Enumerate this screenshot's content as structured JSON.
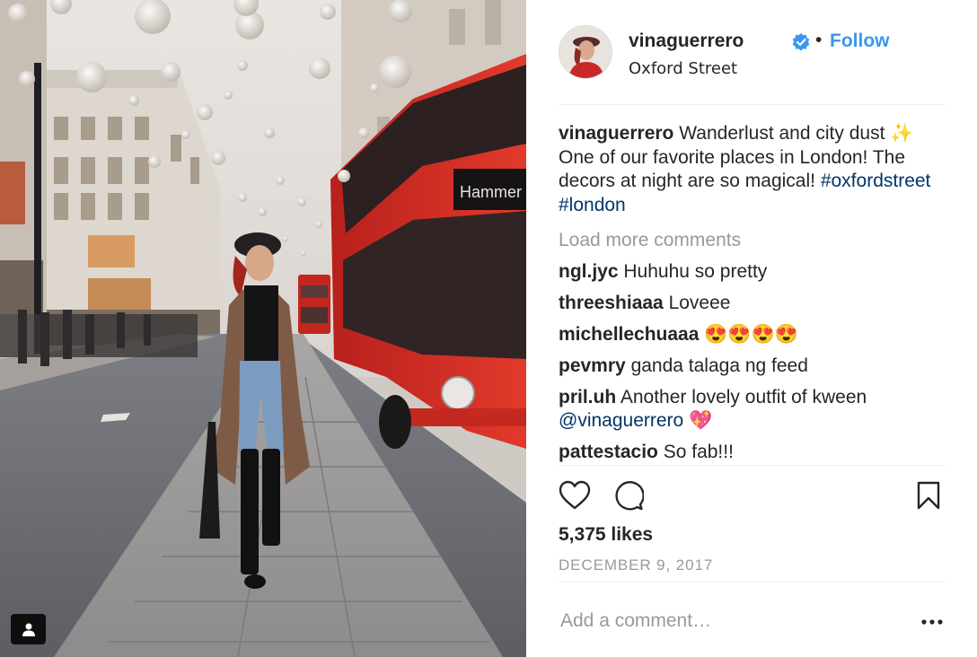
{
  "post": {
    "username": "vinaguerrero",
    "separator": "•",
    "follow_label": "Follow",
    "location": "Oxford Street",
    "verified_icon": "verified-badge-icon",
    "accent_color": "#3897f0",
    "link_color": "#003569"
  },
  "caption": {
    "username": "vinaguerrero",
    "text": "Wanderlust and city dust ✨ One of our favorite places in London! The decors at night are so magical!",
    "hashtags": [
      "#oxfordstreet",
      "#london"
    ]
  },
  "load_more_label": "Load more comments",
  "comments": [
    {
      "user": "ngl.jyc",
      "text": "Huhuhu so pretty"
    },
    {
      "user": "threeshiaaa",
      "text": "Loveee"
    },
    {
      "user": "michellechuaaa",
      "text": "😍😍😍😍"
    },
    {
      "user": "pevmry",
      "text": "ganda talaga ng feed"
    },
    {
      "user": "pril.uh",
      "text": "Another lovely outfit of kween",
      "mention": "@vinaguerrero",
      "emoji": "💖"
    },
    {
      "user": "pattestacio",
      "text": "So fab!!!"
    }
  ],
  "likes_text": "5,375 likes",
  "date_text": "DECEMBER 9, 2017",
  "add_comment_placeholder": "Add a comment…",
  "photo": {
    "bus_sign_text": "Hammer",
    "icons": [
      "user-tag-icon"
    ]
  },
  "actions": {
    "icons": [
      "heart-icon",
      "comment-icon",
      "bookmark-icon",
      "more-options-icon"
    ]
  }
}
